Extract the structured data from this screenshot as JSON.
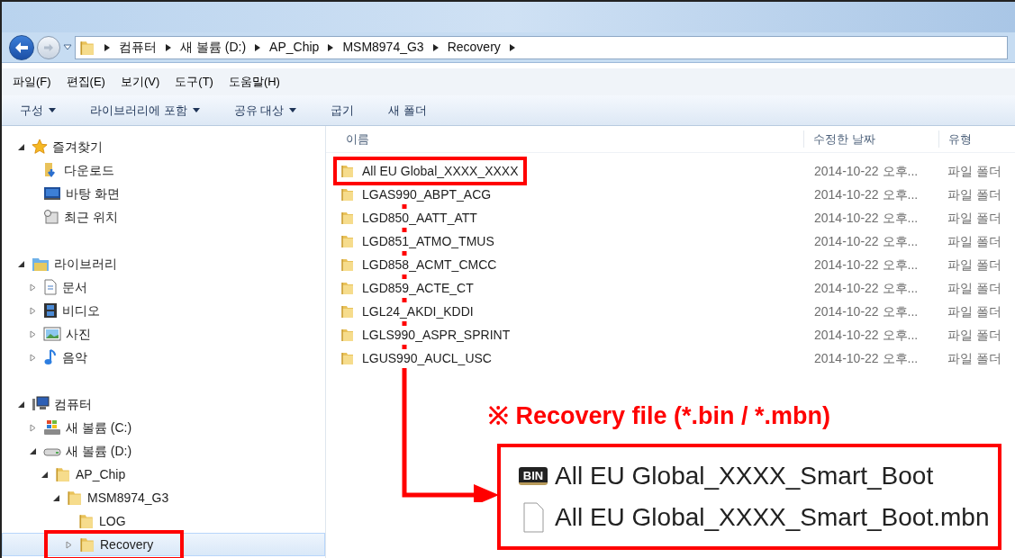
{
  "address_bar": {
    "path": [
      "컴퓨터",
      "새 볼륨 (D:)",
      "AP_Chip",
      "MSM8974_G3",
      "Recovery"
    ]
  },
  "menu_bar": [
    "파일(F)",
    "편집(E)",
    "보기(V)",
    "도구(T)",
    "도움말(H)"
  ],
  "toolbar": [
    {
      "label": "구성",
      "dropdown": true
    },
    {
      "label": "라이브러리에 포함",
      "dropdown": true
    },
    {
      "label": "공유 대상",
      "dropdown": true
    },
    {
      "label": "굽기",
      "dropdown": false
    },
    {
      "label": "새 폴더",
      "dropdown": false
    }
  ],
  "navigation": [
    {
      "label": "즐겨찾기",
      "kind": "star",
      "expanded": true,
      "selected": false,
      "highlighted": false,
      "children": [
        {
          "label": "다운로드",
          "kind": "download",
          "selected": false,
          "highlighted": false
        },
        {
          "label": "바탕 화면",
          "kind": "desktop",
          "selected": false,
          "highlighted": false
        },
        {
          "label": "최근 위치",
          "kind": "recent",
          "selected": false,
          "highlighted": false
        }
      ]
    },
    {
      "label": "라이브러리",
      "kind": "library",
      "expanded": true,
      "selected": false,
      "highlighted": false,
      "children": [
        {
          "label": "문서",
          "kind": "document",
          "expanded": false,
          "selected": false,
          "highlighted": false
        },
        {
          "label": "비디오",
          "kind": "video",
          "expanded": false,
          "selected": false,
          "highlighted": false
        },
        {
          "label": "사진",
          "kind": "photo",
          "expanded": false,
          "selected": false,
          "highlighted": false
        },
        {
          "label": "음악",
          "kind": "music",
          "expanded": false,
          "selected": false,
          "highlighted": false
        }
      ]
    },
    {
      "label": "컴퓨터",
      "kind": "computer",
      "expanded": true,
      "selected": false,
      "highlighted": false,
      "children": [
        {
          "label": "새 볼륨 (C:)",
          "kind": "system-drive",
          "expanded": false,
          "selected": false,
          "highlighted": false
        },
        {
          "label": "새 볼륨 (D:)",
          "kind": "drive",
          "expanded": true,
          "selected": false,
          "highlighted": false,
          "children": [
            {
              "label": "AP_Chip",
              "kind": "folder",
              "expanded": true,
              "selected": false,
              "highlighted": false,
              "children": [
                {
                  "label": "MSM8974_G3",
                  "kind": "folder",
                  "expanded": true,
                  "selected": false,
                  "highlighted": false,
                  "children": [
                    {
                      "label": "LOG",
                      "kind": "folder",
                      "selected": false,
                      "highlighted": false
                    },
                    {
                      "label": "Recovery",
                      "kind": "folder",
                      "expanded": false,
                      "selected": true,
                      "highlighted": true
                    }
                  ]
                }
              ]
            }
          ]
        }
      ]
    }
  ],
  "file_list": {
    "columns": [
      "이름",
      "수정한 날짜",
      "유형"
    ],
    "rows": [
      {
        "name": "All EU Global_XXXX_XXXX",
        "date": "2014-10-22 오후...",
        "type": "파일 폴더",
        "highlighted": true
      },
      {
        "name": "LGAS990_ABPT_ACG",
        "date": "2014-10-22 오후...",
        "type": "파일 폴더",
        "highlighted": false
      },
      {
        "name": "LGD850_AATT_ATT",
        "date": "2014-10-22 오후...",
        "type": "파일 폴더",
        "highlighted": false
      },
      {
        "name": "LGD851_ATMO_TMUS",
        "date": "2014-10-22 오후...",
        "type": "파일 폴더",
        "highlighted": false
      },
      {
        "name": "LGD858_ACMT_CMCC",
        "date": "2014-10-22 오후...",
        "type": "파일 폴더",
        "highlighted": false
      },
      {
        "name": "LGD859_ACTE_CT",
        "date": "2014-10-22 오후...",
        "type": "파일 폴더",
        "highlighted": false
      },
      {
        "name": "LGL24_AKDI_KDDI",
        "date": "2014-10-22 오후...",
        "type": "파일 폴더",
        "highlighted": false
      },
      {
        "name": "LGLS990_ASPR_SPRINT",
        "date": "2014-10-22 오후...",
        "type": "파일 폴더",
        "highlighted": false
      },
      {
        "name": "LGUS990_AUCL_USC",
        "date": "2014-10-22 오후...",
        "type": "파일 폴더",
        "highlighted": false
      }
    ]
  },
  "annotation": {
    "caption": "※ Recovery file (*.bin / *.mbn)",
    "files": [
      {
        "name": "All EU Global_XXXX_Smart_Boot",
        "kind": "bin",
        "icon_label": "BIN"
      },
      {
        "name": "All EU Global_XXXX_Smart_Boot.mbn",
        "kind": "blank"
      }
    ]
  }
}
